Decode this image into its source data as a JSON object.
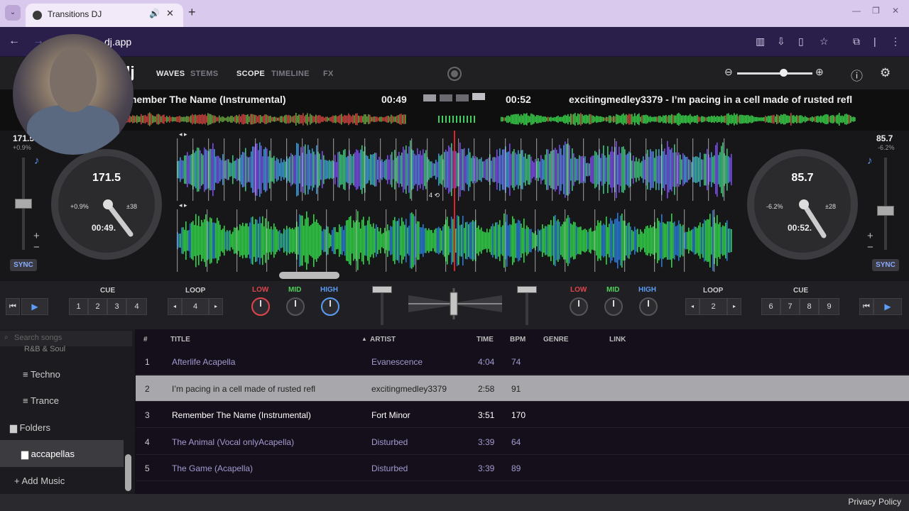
{
  "browser": {
    "tab_title": "Transitions DJ",
    "url": "dj.app",
    "tab_dropdown": "⌄",
    "new_tab": "+",
    "close": "✕"
  },
  "header": {
    "logo_text": "dj",
    "modes": [
      "WAVES",
      "STEMS",
      "SCOPE",
      "TIMELINE",
      "FX"
    ],
    "active_mode": "SCOPE",
    "zoom_level": 0.62
  },
  "deckA": {
    "track_title": "member The Name (Instrumental)",
    "time_elapsed": "00:49",
    "bpm": "171.5",
    "bpm_small": "171.5",
    "pitch_pct": "+0.9%",
    "pitch_range": "±38",
    "platter_time": "00:49.",
    "sync": "SYNC"
  },
  "deckB": {
    "track_title": "excitingmedley3379 - I’m pacing in a cell made of rusted refl",
    "time_elapsed": "00:52",
    "bpm": "85.7",
    "bpm_small": "85.7",
    "pitch_pct": "-6.2%",
    "pitch_range": "±28",
    "platter_time": "00:52.",
    "sync": "SYNC"
  },
  "wave": {
    "loop_marker": "4 ⟲"
  },
  "controls": {
    "cue_label": "CUE",
    "loop_label": "LOOP",
    "eq": [
      "LOW",
      "MID",
      "HIGH"
    ],
    "left_cues": [
      "1",
      "2",
      "3",
      "4"
    ],
    "right_cues": [
      "6",
      "7",
      "8",
      "9"
    ],
    "left_loop_value": "4",
    "right_loop_value": "2"
  },
  "library": {
    "search_placeholder": "Search songs",
    "sidebar": {
      "partial_item": "R&B & Soul",
      "items": [
        "Techno",
        "Trance"
      ],
      "folders_label": "Folders",
      "selected_folder": "accapellas",
      "add_music": "Add Music"
    },
    "columns": [
      "#",
      "TITLE",
      "ARTIST",
      "TIME",
      "BPM",
      "GENRE",
      "LINK"
    ],
    "rows": [
      {
        "num": "1",
        "title": "Afterlife Acapella",
        "artist": "Evanescence",
        "time": "4:04",
        "bpm": "74"
      },
      {
        "num": "2",
        "title": "I’m pacing in a cell made of rusted refl",
        "artist": "excitingmedley3379",
        "time": "2:58",
        "bpm": "91"
      },
      {
        "num": "3",
        "title": "Remember The Name (Instrumental)",
        "artist": "Fort Minor",
        "time": "3:51",
        "bpm": "170"
      },
      {
        "num": "4",
        "title": "The Animal (Vocal onlyAcapella)",
        "artist": "Disturbed",
        "time": "3:39",
        "bpm": "64"
      },
      {
        "num": "5",
        "title": "The Game (Acapella)",
        "artist": "Disturbed",
        "time": "3:39",
        "bpm": "89"
      }
    ]
  },
  "footer": {
    "privacy": "Privacy Policy"
  },
  "colors": {
    "accent_blue": "#5b9cf2",
    "playhead_red": "#e0222b",
    "eq_low": "#e0454b",
    "eq_mid": "#4cd25a",
    "selected_row": "#a8a8ac"
  }
}
